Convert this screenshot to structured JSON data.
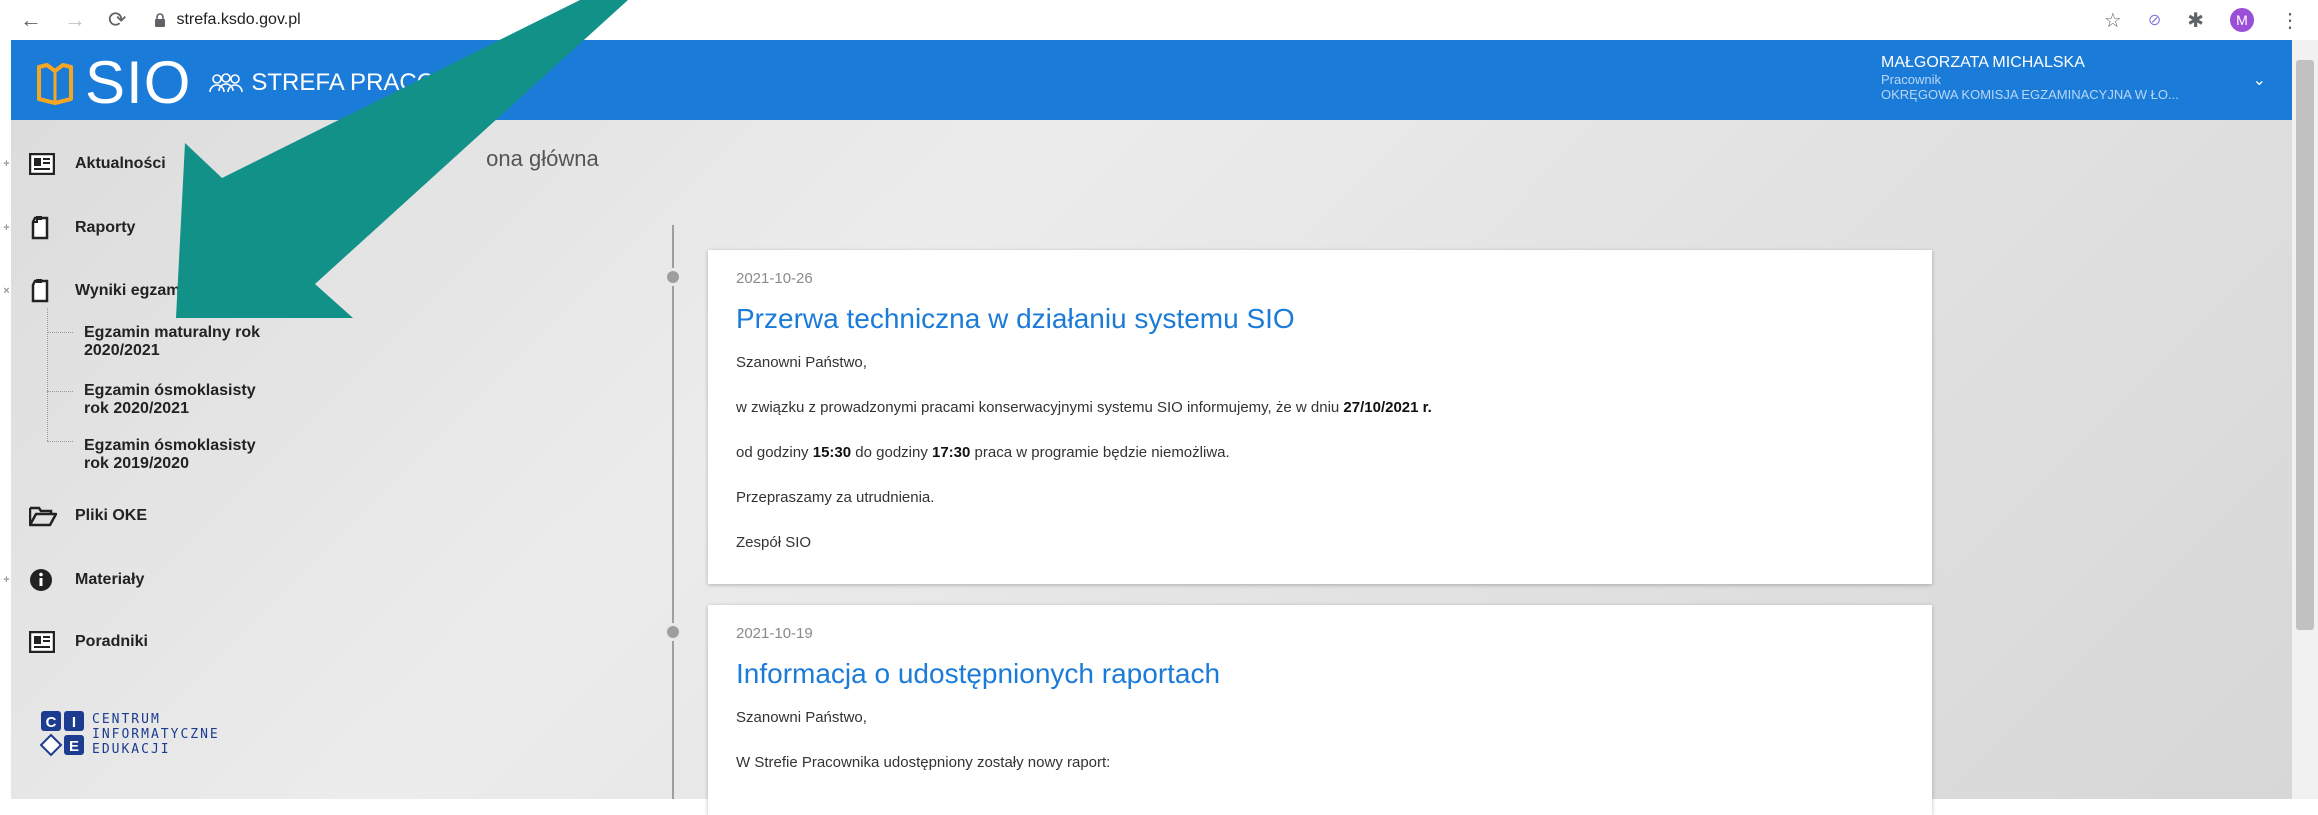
{
  "browser": {
    "url": "strefa.ksdo.gov.pl",
    "avatar_letter": "M"
  },
  "header": {
    "logo_text": "SIO",
    "section_title": "STREFA PRACOWNI",
    "user_name": "MAŁGORZATA MICHALSKA",
    "user_role": "Pracownik",
    "user_org": "OKRĘGOWA KOMISJA EGZAMINACYJNA W ŁO...",
    "brand_color": "#1a7bd8",
    "logo_color": "#f5a623"
  },
  "sidebar": {
    "items": [
      {
        "label": "Aktualności",
        "icon": "newspaper-icon",
        "toggle": "+"
      },
      {
        "label": "Raporty",
        "icon": "document-icon",
        "toggle": "+"
      },
      {
        "label": "Wyniki egzaminów",
        "icon": "document-icon",
        "toggle": "×"
      },
      {
        "label": "Pliki OKE",
        "icon": "folder-open-icon",
        "toggle": ""
      },
      {
        "label": "Materiały",
        "icon": "info-circle-icon",
        "toggle": "+"
      },
      {
        "label": "Poradniki",
        "icon": "newspaper-icon",
        "toggle": ""
      }
    ],
    "subitems": [
      {
        "line1": "Egzamin maturalny rok",
        "line2": "2020/2021"
      },
      {
        "line1": "Egzamin ósmoklasisty",
        "line2": "rok 2020/2021"
      },
      {
        "line1": "Egzamin ósmoklasisty",
        "line2": "rok 2019/2020"
      }
    ],
    "footer_logo": {
      "line1": "CENTRUM",
      "line2": "INFORMATYCZNE",
      "line3": "EDUKACJI",
      "letters": [
        "C",
        "I",
        "E"
      ]
    }
  },
  "breadcrumb": {
    "part1": "Strona g",
    "part2": "ona główna"
  },
  "news": [
    {
      "date": "2021-10-26",
      "title": "Przerwa techniczna w działaniu systemu SIO",
      "greeting": "Szanowni Państwo,",
      "p1_pre": "w związku z prowadzonymi pracami konserwacyjnymi systemu SIO informujemy, że w dniu ",
      "p1_bold": "27/10/2021 r.",
      "p2_pre": "od godziny ",
      "p2_b1": "15:30",
      "p2_mid": " do godziny ",
      "p2_b2": "17:30",
      "p2_post": " praca w programie będzie niemożliwa.",
      "p3": "Przepraszamy za utrudnienia.",
      "p4": "Zespół SIO"
    },
    {
      "date": "2021-10-19",
      "title": "Informacja o udostępnionych raportach",
      "greeting": "Szanowni Państwo,",
      "p1": "W Strefie Pracownika udostępniony zostały nowy raport:"
    }
  ],
  "annotation": {
    "arrow_color": "#119187"
  }
}
